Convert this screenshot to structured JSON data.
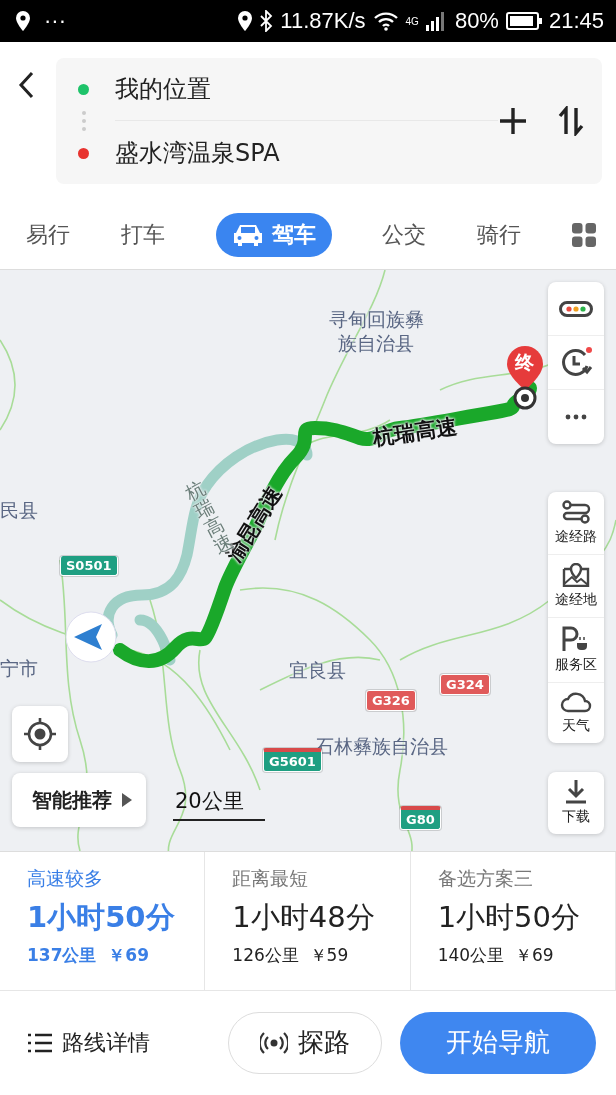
{
  "status_bar": {
    "more": "···",
    "speed": "11.87K/s",
    "network": "4G",
    "battery": "80%",
    "time": "21:45"
  },
  "route_inputs": [
    {
      "kind": "origin",
      "text": "我的位置",
      "color": "#1ec36a"
    },
    {
      "kind": "destination",
      "text": "盛水湾温泉SPA",
      "color": "#e8332f"
    }
  ],
  "modes": [
    {
      "label": "易行",
      "selected": false
    },
    {
      "label": "打车",
      "selected": false
    },
    {
      "label": "驾车",
      "selected": true
    },
    {
      "label": "公交",
      "selected": false
    },
    {
      "label": "骑行",
      "selected": false
    }
  ],
  "map": {
    "labels": [
      {
        "text": "寻甸回族彝族自治县",
        "kind": "place"
      },
      {
        "text": "民县",
        "kind": "place"
      },
      {
        "text": "宁市",
        "kind": "place"
      },
      {
        "text": "宜良县",
        "kind": "place"
      },
      {
        "text": "石林彝族自治县",
        "kind": "place"
      },
      {
        "text": "杭瑞高速",
        "kind": "route"
      },
      {
        "text": "渝昆高速",
        "kind": "route"
      },
      {
        "text": "杭瑞高速",
        "kind": "alt"
      }
    ],
    "shields": [
      {
        "text": "S0501",
        "kind": "provincial"
      },
      {
        "text": "G326",
        "kind": "national"
      },
      {
        "text": "G324",
        "kind": "national"
      },
      {
        "text": "G5601",
        "kind": "expressway"
      },
      {
        "text": "G80",
        "kind": "expressway"
      }
    ],
    "end_marker": "终",
    "recommend": "智能推荐",
    "scale": "20公里",
    "tools": [
      {
        "label": "途经路",
        "kind": "waypath"
      },
      {
        "label": "途经地",
        "kind": "waypoint"
      },
      {
        "label": "服务区",
        "kind": "service"
      },
      {
        "label": "天气",
        "kind": "weather"
      }
    ],
    "download": "下载"
  },
  "route_options": [
    {
      "title": "高速较多",
      "duration": "1小时50分",
      "distance": "137公里",
      "price": "￥69",
      "selected": true
    },
    {
      "title": "距离最短",
      "duration": "1小时48分",
      "distance": "126公里",
      "price": "￥59",
      "selected": false
    },
    {
      "title": "备选方案三",
      "duration": "1小时50分",
      "distance": "140公里",
      "price": "￥69",
      "selected": false
    }
  ],
  "actions": {
    "details": "路线详情",
    "explore": "探路",
    "navigate": "开始导航"
  }
}
